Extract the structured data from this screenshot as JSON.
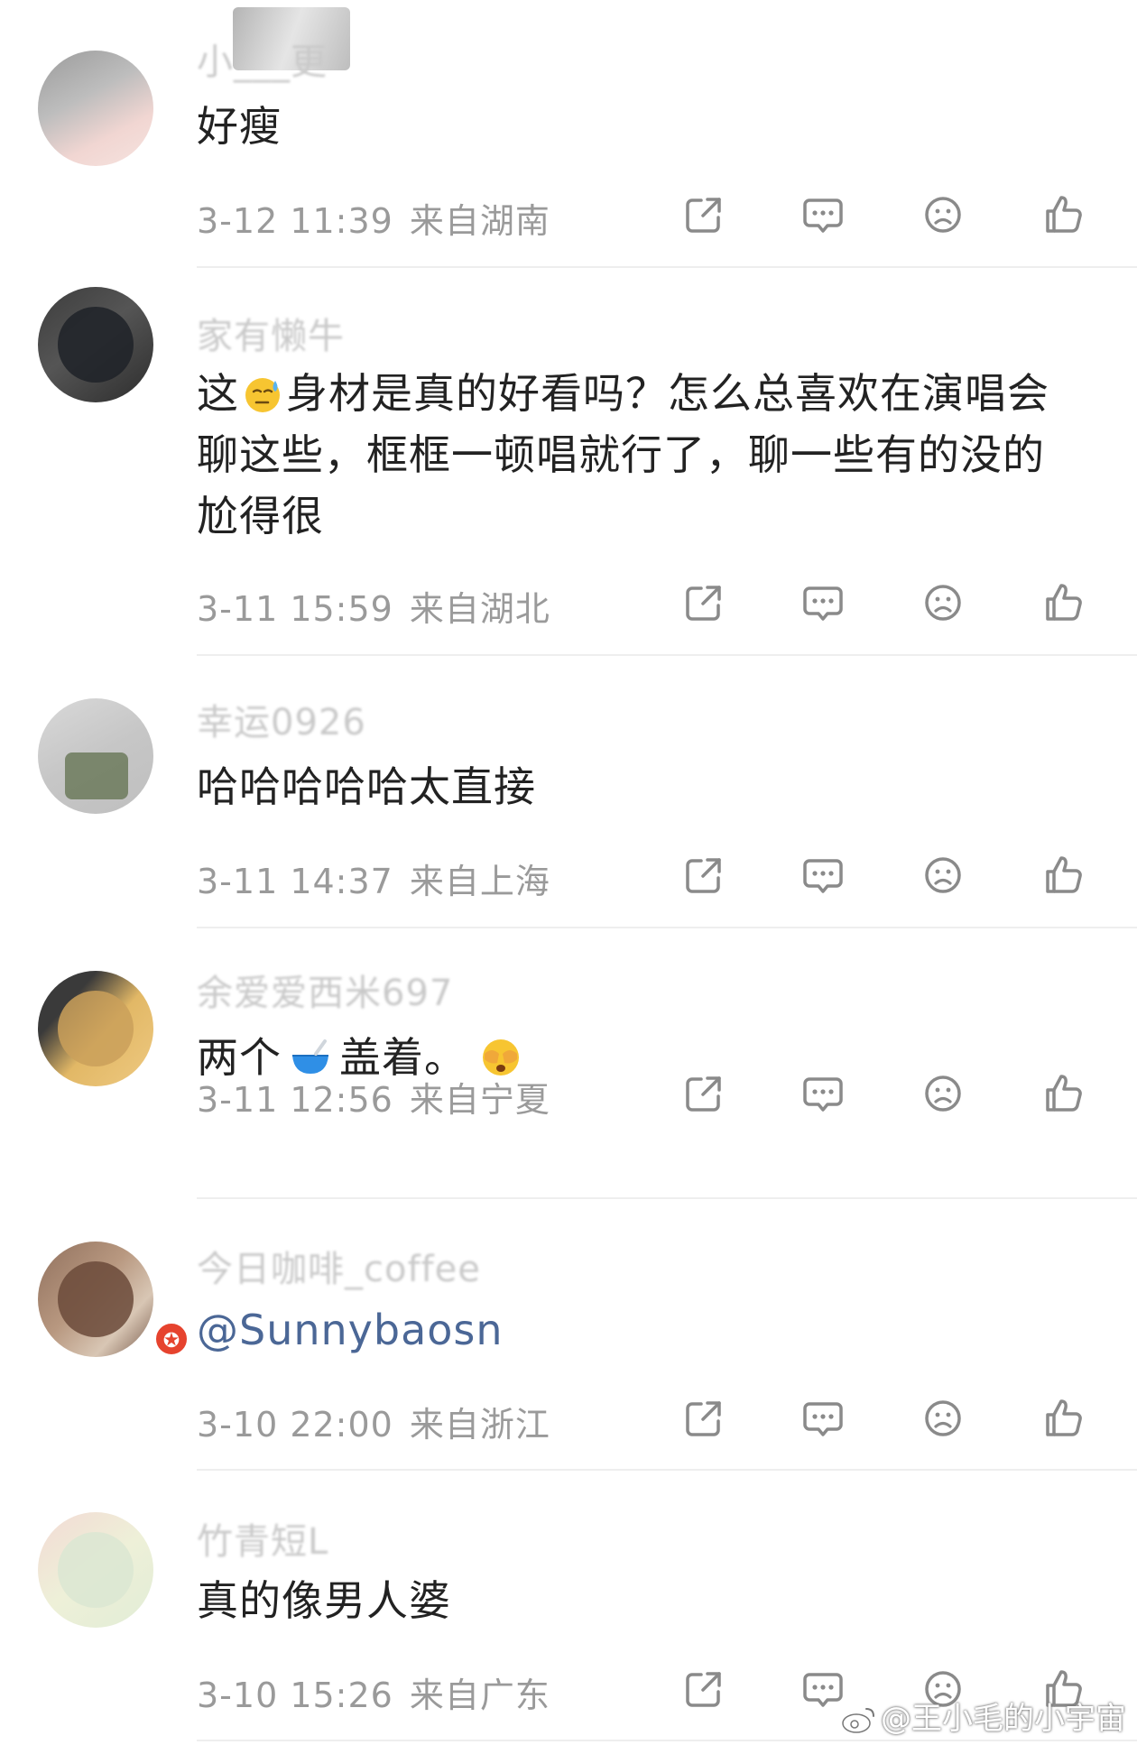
{
  "comments": [
    {
      "username": "小___更",
      "text": "好瘦",
      "time": "3-12 11:39",
      "location": "来自湖南"
    },
    {
      "username": "家有懒牛",
      "text_part1": "这",
      "text_part2": "身材是真的好看吗？怎么总喜欢在演唱会聊这些，框框一顿唱就行了，聊一些有的没的尬得很",
      "time": "3-11 15:59",
      "location": "来自湖北"
    },
    {
      "username": "幸运0926",
      "text": "哈哈哈哈哈太直接",
      "time": "3-11 14:37",
      "location": "来自上海"
    },
    {
      "username": "余爱爱西米697",
      "text_part1": "两个",
      "text_part2": "盖着。",
      "time": "3-11 12:56",
      "location": "来自宁夏"
    },
    {
      "username": "今日咖啡_coffee",
      "text": "@Sunnybaosn",
      "time": "3-10 22:00",
      "location": "来自浙江"
    },
    {
      "username": "竹青短L",
      "text": "真的像男人婆",
      "time": "3-10 15:26",
      "location": "来自广东"
    }
  ],
  "icons": {
    "share": "share-icon",
    "reply": "comment-bubble-icon",
    "dislike": "frown-face-icon",
    "like": "thumbs-up-icon",
    "emoji_sweat": "sweat-emoji-icon",
    "emoji_bowl": "bowl-emoji-icon",
    "emoji_cover": "cover-eyes-emoji-icon"
  },
  "watermark": "@王小毛的小宇宙",
  "badge_symbol": "✪",
  "colors": {
    "text": "#222222",
    "meta": "#9a9a9a",
    "mention": "#4b6796",
    "icon": "#8a8a8a",
    "divider": "#eeeeee"
  }
}
